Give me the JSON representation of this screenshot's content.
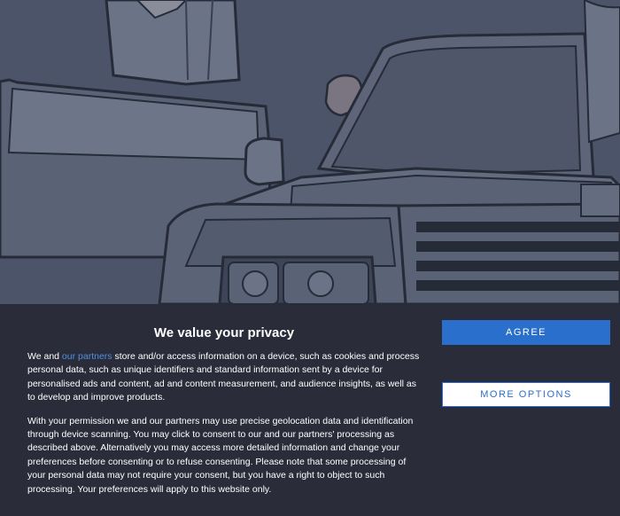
{
  "consent": {
    "title": "We value your privacy",
    "para1": {
      "before": "We and ",
      "link": "our partners",
      "after": " store and/or access information on a device, such as cookies and process personal data, such as unique identifiers and standard information sent by a device for personalised ads and content, ad and content measurement, and audience insights, as well as to develop and improve products."
    },
    "para2": "With your permission we and our partners may use precise geolocation data and identification through device scanning. You may click to consent to our and our partners' processing as described above. Alternatively you may access more detailed information and change your preferences before consenting or to refuse consenting. Please note that some processing of your personal data may not require your consent, but you have a right to object to such processing. Your preferences will apply to this website only.",
    "agree_label": "AGREE",
    "more_options_label": "MORE OPTIONS"
  },
  "colors": {
    "backdrop": "#4b5468",
    "banner_bg": "#2b2c3a",
    "accent": "#2a6fcb",
    "link": "#4f8fe0"
  }
}
